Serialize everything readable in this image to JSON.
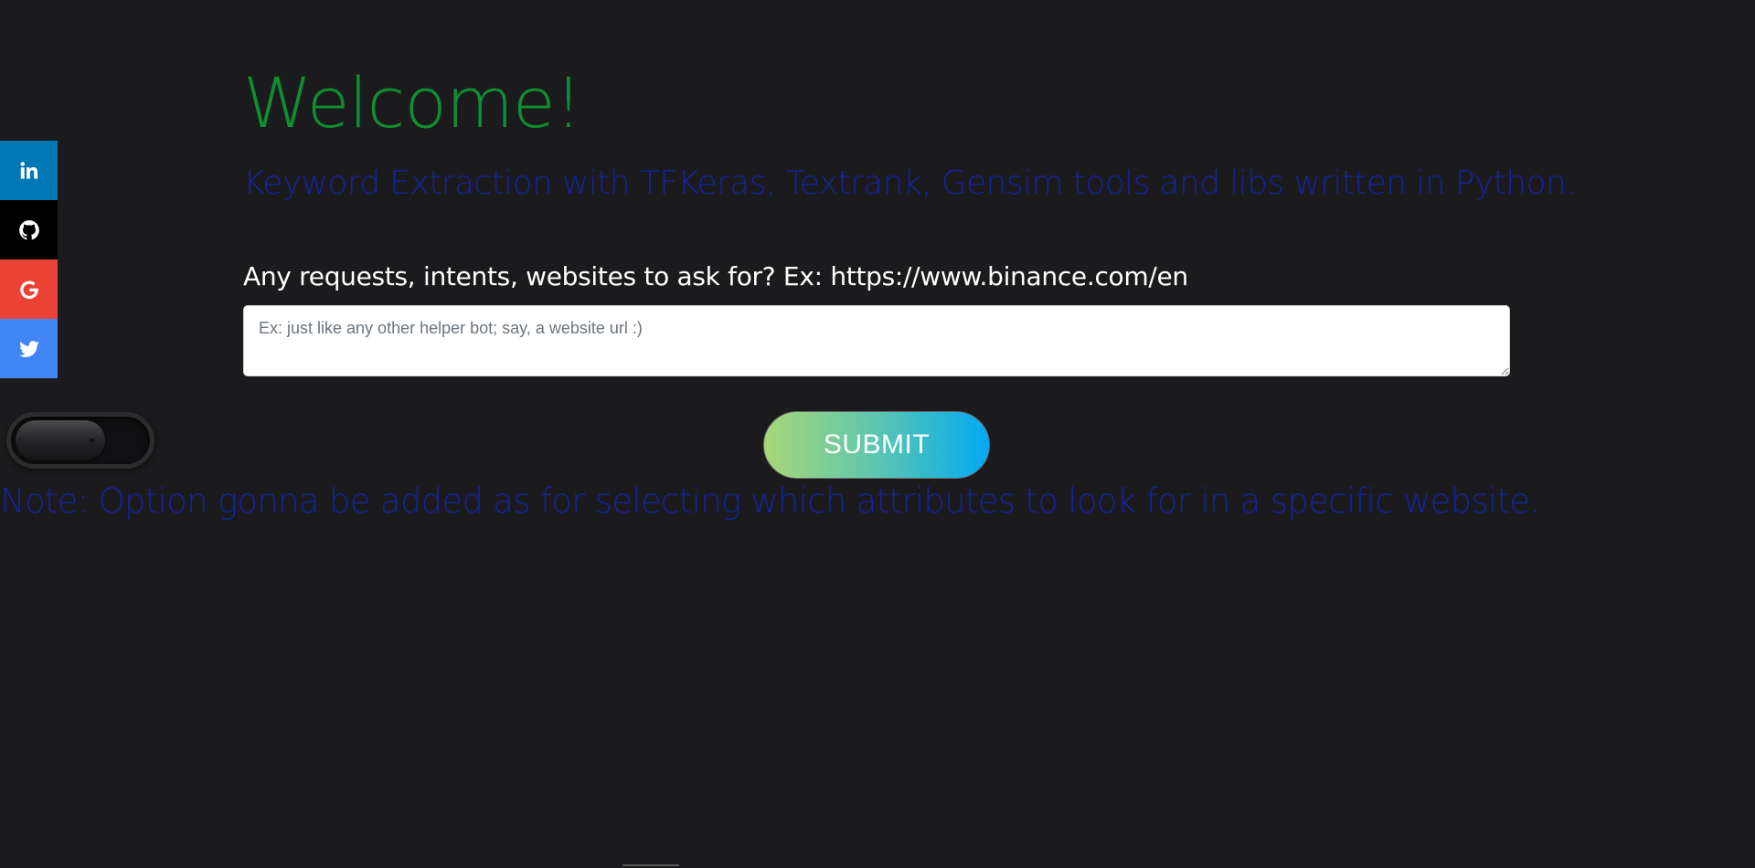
{
  "social": {
    "items": [
      {
        "name": "linkedin",
        "icon": "linkedin-icon",
        "color": "#0077b5"
      },
      {
        "name": "github",
        "icon": "github-icon",
        "color": "#000000"
      },
      {
        "name": "google",
        "icon": "google-icon",
        "color": "#ea4335"
      },
      {
        "name": "twitter",
        "icon": "twitter-icon",
        "color": "#4285f4"
      }
    ]
  },
  "header": {
    "title": "Welcome!",
    "subtitle": "Keyword Extraction with TFKeras, Textrank, Gensim tools and libs written in Python."
  },
  "form": {
    "label": "Any requests, intents, websites to ask for? Ex: https://www.binance.com/en",
    "input_value": "",
    "input_placeholder": "Ex: just like any other helper bot; say, a website url :)",
    "submit_label": "SUBMIT"
  },
  "toggle": {
    "state": "off"
  },
  "note": "Note: Option gonna be added as for selecting which attributes to look for in a specific website.",
  "colors": {
    "background": "#1b1b1d",
    "title": "#0f8f31",
    "subtitle": "#14249c",
    "label": "#ffffff",
    "submit_gradient_start": "#a8d777",
    "submit_gradient_end": "#03a9f4"
  }
}
